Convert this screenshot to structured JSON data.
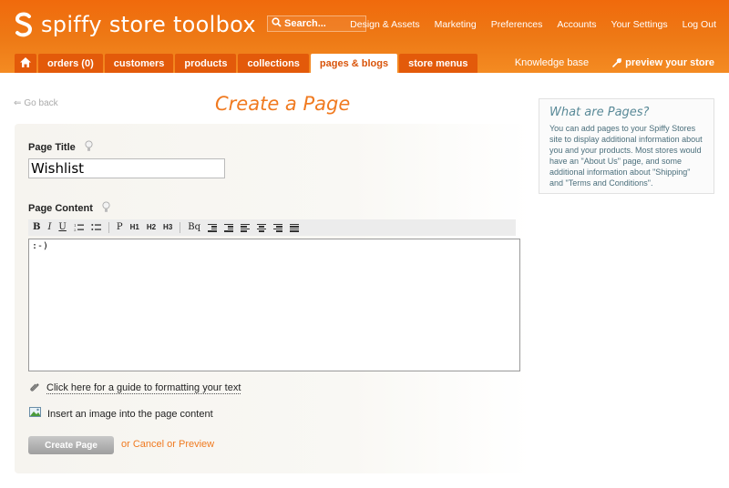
{
  "header": {
    "logo_text": "spiffy store toolbox",
    "search_placeholder": "Search...",
    "topnav": [
      "Design & Assets",
      "Marketing",
      "Preferences",
      "Accounts",
      "Your Settings",
      "Log Out"
    ],
    "tabs": [
      {
        "label": "orders (0)",
        "active": false
      },
      {
        "label": "customers",
        "active": false
      },
      {
        "label": "products",
        "active": false
      },
      {
        "label": "collections",
        "active": false
      },
      {
        "label": "pages & blogs",
        "active": true
      },
      {
        "label": "store menus",
        "active": false
      }
    ],
    "knowledge_base": "Knowledge base",
    "preview_store": "preview your store"
  },
  "content": {
    "go_back": "Go back",
    "page_title": "Create a Page",
    "title_label": "Page Title",
    "title_value": "Wishlist",
    "content_label": "Page Content",
    "content_value": ":-)",
    "toolbar": {
      "bold": "B",
      "italic": "I",
      "underline": "U",
      "paragraph": "P",
      "h1": "H1",
      "h2": "H2",
      "h3": "H3",
      "blockquote": "Bq"
    },
    "guide_link": "Click here for a guide to formatting your text",
    "image_link": "Insert an image into the page content",
    "create_button": "Create Page",
    "or1": "or",
    "cancel": "Cancel",
    "or2": "or",
    "preview": "Preview"
  },
  "sidebar": {
    "title": "What are Pages?",
    "text": "You can add pages to your Spiffy Stores site to display additional information about you and your products. Most stores would have an \"About Us\" page, and some additional information about \"Shipping\" and \"Terms and Conditions\"."
  },
  "colors": {
    "brand_orange": "#f06a0c",
    "active_tab_text": "#d9540a",
    "title_orange": "#f07a20",
    "sidebar_teal": "#5a8a98"
  }
}
